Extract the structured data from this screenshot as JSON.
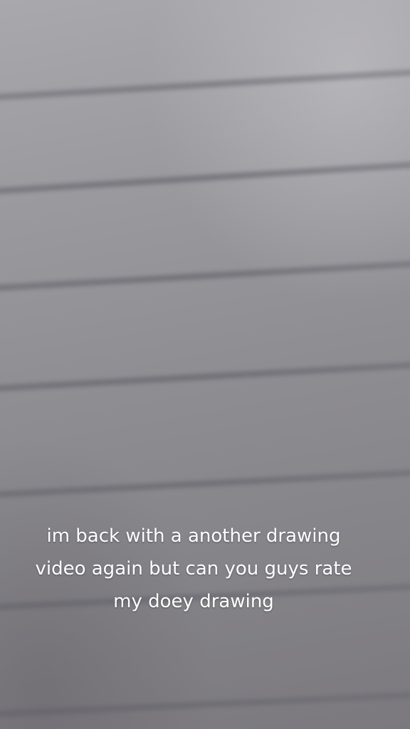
{
  "overlay_caption": {
    "lines": [
      "im back with a another drawing",
      "video again but can you guys rate",
      "my doey drawing"
    ]
  }
}
